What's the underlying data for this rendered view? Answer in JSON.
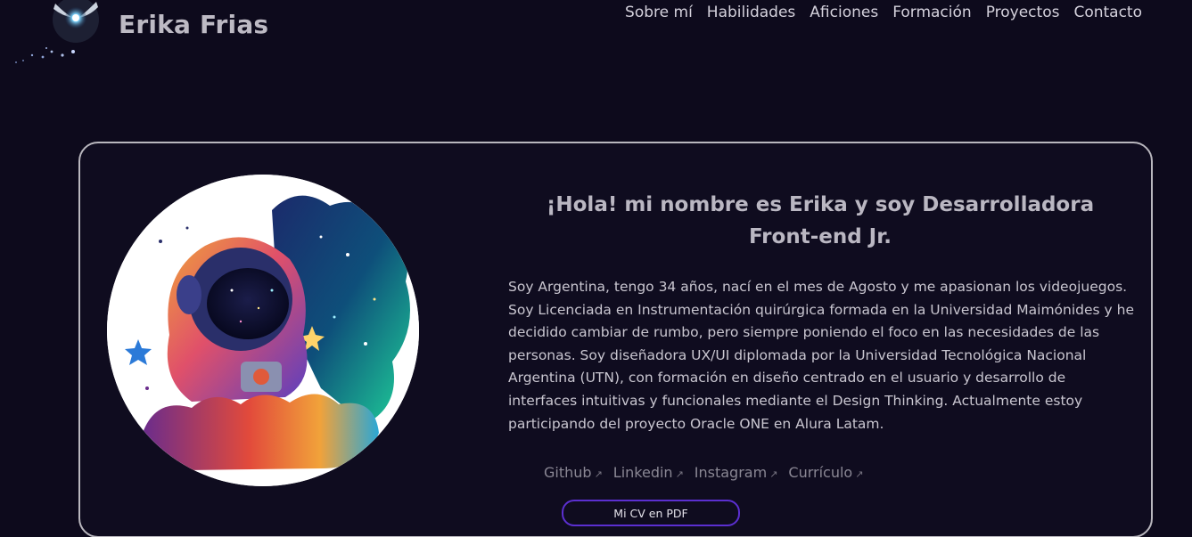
{
  "header": {
    "brand": "Erika Frias",
    "logo_icon": "fairy-orb-icon",
    "nav": [
      {
        "label": "Sobre mí"
      },
      {
        "label": "Habilidades"
      },
      {
        "label": "Aficiones"
      },
      {
        "label": "Formación"
      },
      {
        "label": "Proyectos"
      },
      {
        "label": "Contacto"
      }
    ]
  },
  "hero": {
    "avatar_icon": "astronaut-illustration",
    "headline": "¡Hola! mi nombre es Erika y soy Desarrolladora Front-end Jr.",
    "bio": "Soy Argentina, tengo 34 años, nací en el mes de Agosto y me apasionan los videojuegos. Soy Licenciada en Instrumentación quirúrgica formada en la Universidad Maimónides y he decidido cambiar de rumbo, pero siempre poniendo el foco en las necesidades de las personas. Soy diseñadora UX/UI diplomada por la Universidad Tecnológica Nacional Argentina (UTN), con formación en diseño centrado en el usuario y desarrollo de interfaces intuitivas y funcionales mediante el Design Thinking. Actualmente estoy participando del proyecto Oracle ONE en Alura Latam.",
    "links": [
      {
        "label": "Github",
        "arrow": "↗"
      },
      {
        "label": "Linkedin",
        "arrow": "↗"
      },
      {
        "label": "Instagram",
        "arrow": "↗"
      },
      {
        "label": "Currículo",
        "arrow": "↗"
      }
    ],
    "cv_button": "Mi CV en PDF"
  },
  "colors": {
    "background": "#0d0a1c",
    "card_border": "#b9b7be",
    "button_border": "#5b2fd0",
    "headline": "#bab7c2"
  }
}
